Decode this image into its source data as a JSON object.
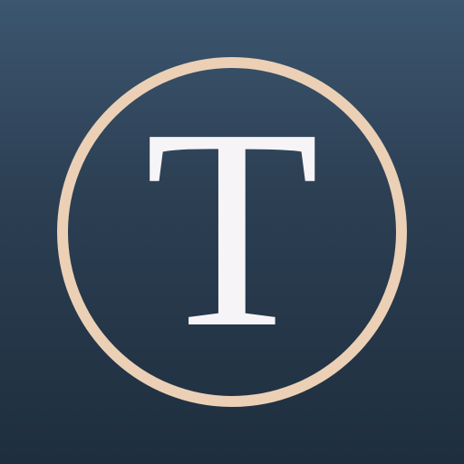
{
  "app_icon": {
    "letter": "T",
    "colors": {
      "background_top": "#3c566f",
      "background_bottom": "#1e2e3e",
      "ring": "#ebd0b6",
      "letter": "#f6f4f6"
    }
  }
}
